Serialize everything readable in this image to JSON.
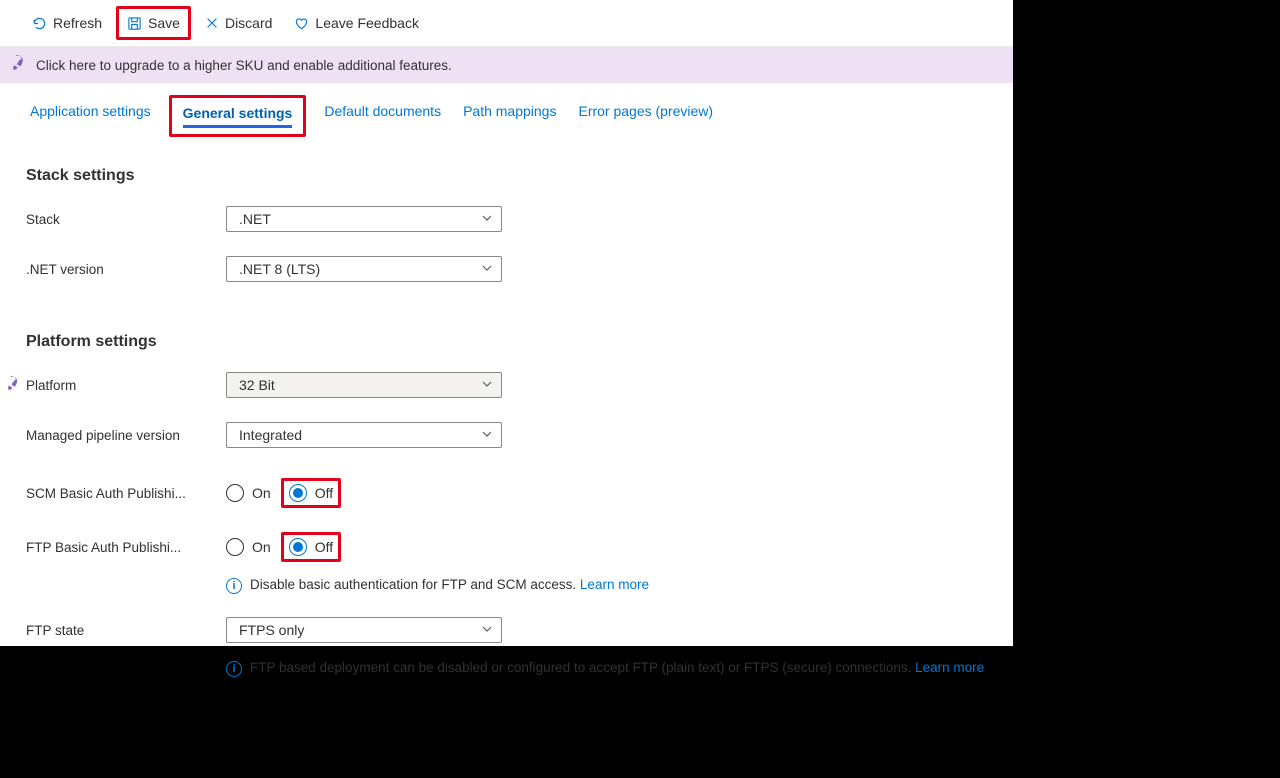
{
  "toolbar": {
    "refresh": "Refresh",
    "save": "Save",
    "discard": "Discard",
    "feedback": "Leave Feedback"
  },
  "banner": {
    "text": "Click here to upgrade to a higher SKU and enable additional features."
  },
  "tabs": {
    "app_settings": "Application settings",
    "general_settings": "General settings",
    "default_docs": "Default documents",
    "path_mappings": "Path mappings",
    "error_pages": "Error pages (preview)"
  },
  "sections": {
    "stack": "Stack settings",
    "platform": "Platform settings"
  },
  "labels": {
    "stack": "Stack",
    "net_version": ".NET version",
    "platform": "Platform",
    "pipeline": "Managed pipeline version",
    "scm": "SCM Basic Auth Publishi...",
    "ftp": "FTP Basic Auth Publishi...",
    "ftp_state": "FTP state"
  },
  "values": {
    "stack": ".NET",
    "net_version": ".NET 8 (LTS)",
    "platform": "32 Bit",
    "pipeline": "Integrated",
    "ftp_state": "FTPS only"
  },
  "radio": {
    "on": "On",
    "off": "Off"
  },
  "info": {
    "basic_auth": "Disable basic authentication for FTP and SCM access.",
    "ftp_state": "FTP based deployment can be disabled or configured to accept FTP (plain text) or FTPS (secure) connections.",
    "learn_more": "Learn more"
  }
}
